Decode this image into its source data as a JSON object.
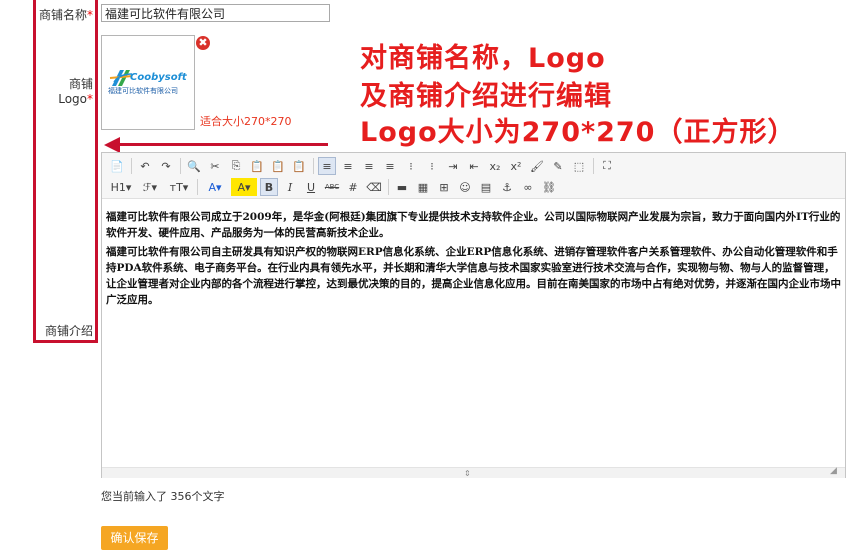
{
  "form": {
    "shop_name_label": "商铺名称",
    "shop_name_value": "福建可比软件有限公司",
    "logo_label": "商铺Logo",
    "required_mark": "*",
    "logo_size_hint": "适合大小270*270",
    "shop_intro_label": "商铺介绍",
    "char_count_text": "您当前输入了 356个文字",
    "save_label": "确认保存"
  },
  "logo": {
    "brand_text": "Coobysoft",
    "company_text": "福建可比软件有限公司",
    "delete_glyph": "✖"
  },
  "annotation": {
    "line1": "对商铺名称，Logo",
    "line2": "及商铺介绍进行编辑",
    "line3": "Logo大小为270*270（正方形）"
  },
  "editor": {
    "paragraphs": [
      "福建可比软件有限公司成立于2009年，是华金(阿根廷)集团旗下专业提供技术支持软件企业。公司以国际物联网产业发展为宗旨，致力于面向国内外IT行业的软件开发、硬件应用、产品服务为一体的民营高新技术企业。",
      "福建可比软件有限公司自主研发具有知识产权的物联网ERP信息化系统、企业ERP信息化系统、进销存管理软件客户关系管理软件、办公自动化管理软件和手持PDA软件系统、电子商务平台。在行业内具有领先水平，并长期和清华大学信息与技术国家实验室进行技术交流与合作，实现物与物、物与人的监督管理，让企业管理者对企业内部的各个流程进行掌控，达到最优决策的目的，提高企业信息化应用。目前在南美国家的市场中占有绝对优势，并逐渐在国内企业市场中广泛应用。"
    ],
    "toolbar_row1": [
      "📄",
      "↶",
      "↷",
      "🔍",
      "✂",
      "⎘",
      "📋",
      "📋",
      "📋",
      "≡",
      "≡",
      "≡",
      "≡",
      "⁝",
      "⁝",
      "⇥",
      "⇤",
      "x₂",
      "x²",
      "🖌",
      "✎",
      "⬚",
      "⛶"
    ],
    "toolbar_row2": [
      "H1▾",
      "ℱ▾",
      "тT▾",
      "A▾",
      "A▾",
      "B",
      "I",
      "U",
      "ABC",
      "#",
      "⌫",
      "▬",
      "▦",
      "⊞",
      "☺",
      "▤",
      "⚓",
      "∞",
      "⛓"
    ]
  },
  "colors": {
    "annotation_red": "#e61e1e",
    "save_orange": "#f5a623",
    "required_red": "#ee0000"
  }
}
